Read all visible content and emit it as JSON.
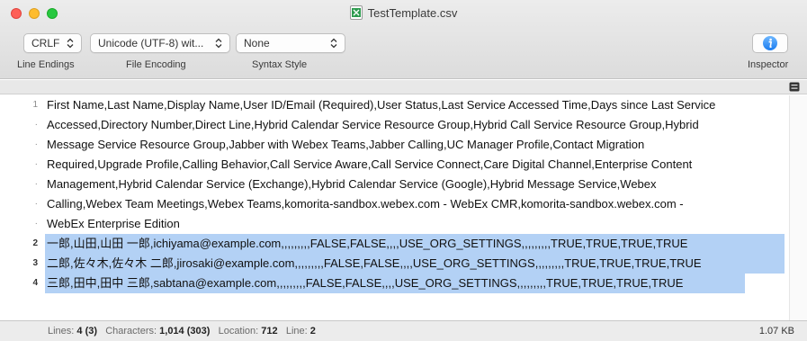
{
  "window": {
    "title": "TestTemplate.csv"
  },
  "toolbar": {
    "line_endings": {
      "value": "CRLF",
      "label": "Line Endings"
    },
    "file_encoding": {
      "value": "Unicode (UTF-8) wit...",
      "label": "File Encoding"
    },
    "syntax_style": {
      "value": "None",
      "label": "Syntax Style"
    },
    "inspector": {
      "label": "Inspector"
    }
  },
  "editor": {
    "line_numbers": [
      "1",
      "·",
      "·",
      "·",
      "·",
      "·",
      "·",
      "2",
      "3",
      "4"
    ],
    "lines": [
      "First Name,Last Name,Display Name,User ID/Email (Required),User Status,Last Service Accessed Time,Days since Last Service",
      "Accessed,Directory Number,Direct Line,Hybrid Calendar Service Resource Group,Hybrid Call Service Resource Group,Hybrid",
      "Message Service Resource Group,Jabber with Webex Teams,Jabber Calling,UC Manager Profile,Contact Migration",
      "Required,Upgrade Profile,Calling Behavior,Call Service Aware,Call Service Connect,Care Digital Channel,Enterprise Content",
      "Management,Hybrid Calendar Service (Exchange),Hybrid Calendar Service (Google),Hybrid Message Service,Webex",
      "Calling,Webex Team Meetings,Webex Teams,komorita-sandbox.webex.com - WebEx CMR,komorita-sandbox.webex.com -",
      "WebEx Enterprise Edition",
      "一郎,山田,山田 一郎,ichiyama@example.com,,,,,,,,,FALSE,FALSE,,,,USE_ORG_SETTINGS,,,,,,,,,TRUE,TRUE,TRUE,TRUE",
      "二郎,佐々木,佐々木 二郎,jirosaki@example.com,,,,,,,,,FALSE,FALSE,,,,USE_ORG_SETTINGS,,,,,,,,,TRUE,TRUE,TRUE,TRUE",
      "三郎,田中,田中 三郎,sabtana@example.com,,,,,,,,,FALSE,FALSE,,,,USE_ORG_SETTINGS,,,,,,,,,TRUE,TRUE,TRUE,TRUE"
    ]
  },
  "status": {
    "lines_label": "Lines:",
    "lines_value": "4 (3)",
    "chars_label": "Characters:",
    "chars_value": "1,014 (303)",
    "location_label": "Location:",
    "location_value": "712",
    "line_label": "Line:",
    "line_value": "2",
    "size": "1.07 KB"
  },
  "colors": {
    "selection": "#b3d1f5",
    "close": "#fe5f57",
    "minimize": "#febc2e",
    "maximize": "#28c840",
    "inspector_icon": "#1e90ff"
  }
}
